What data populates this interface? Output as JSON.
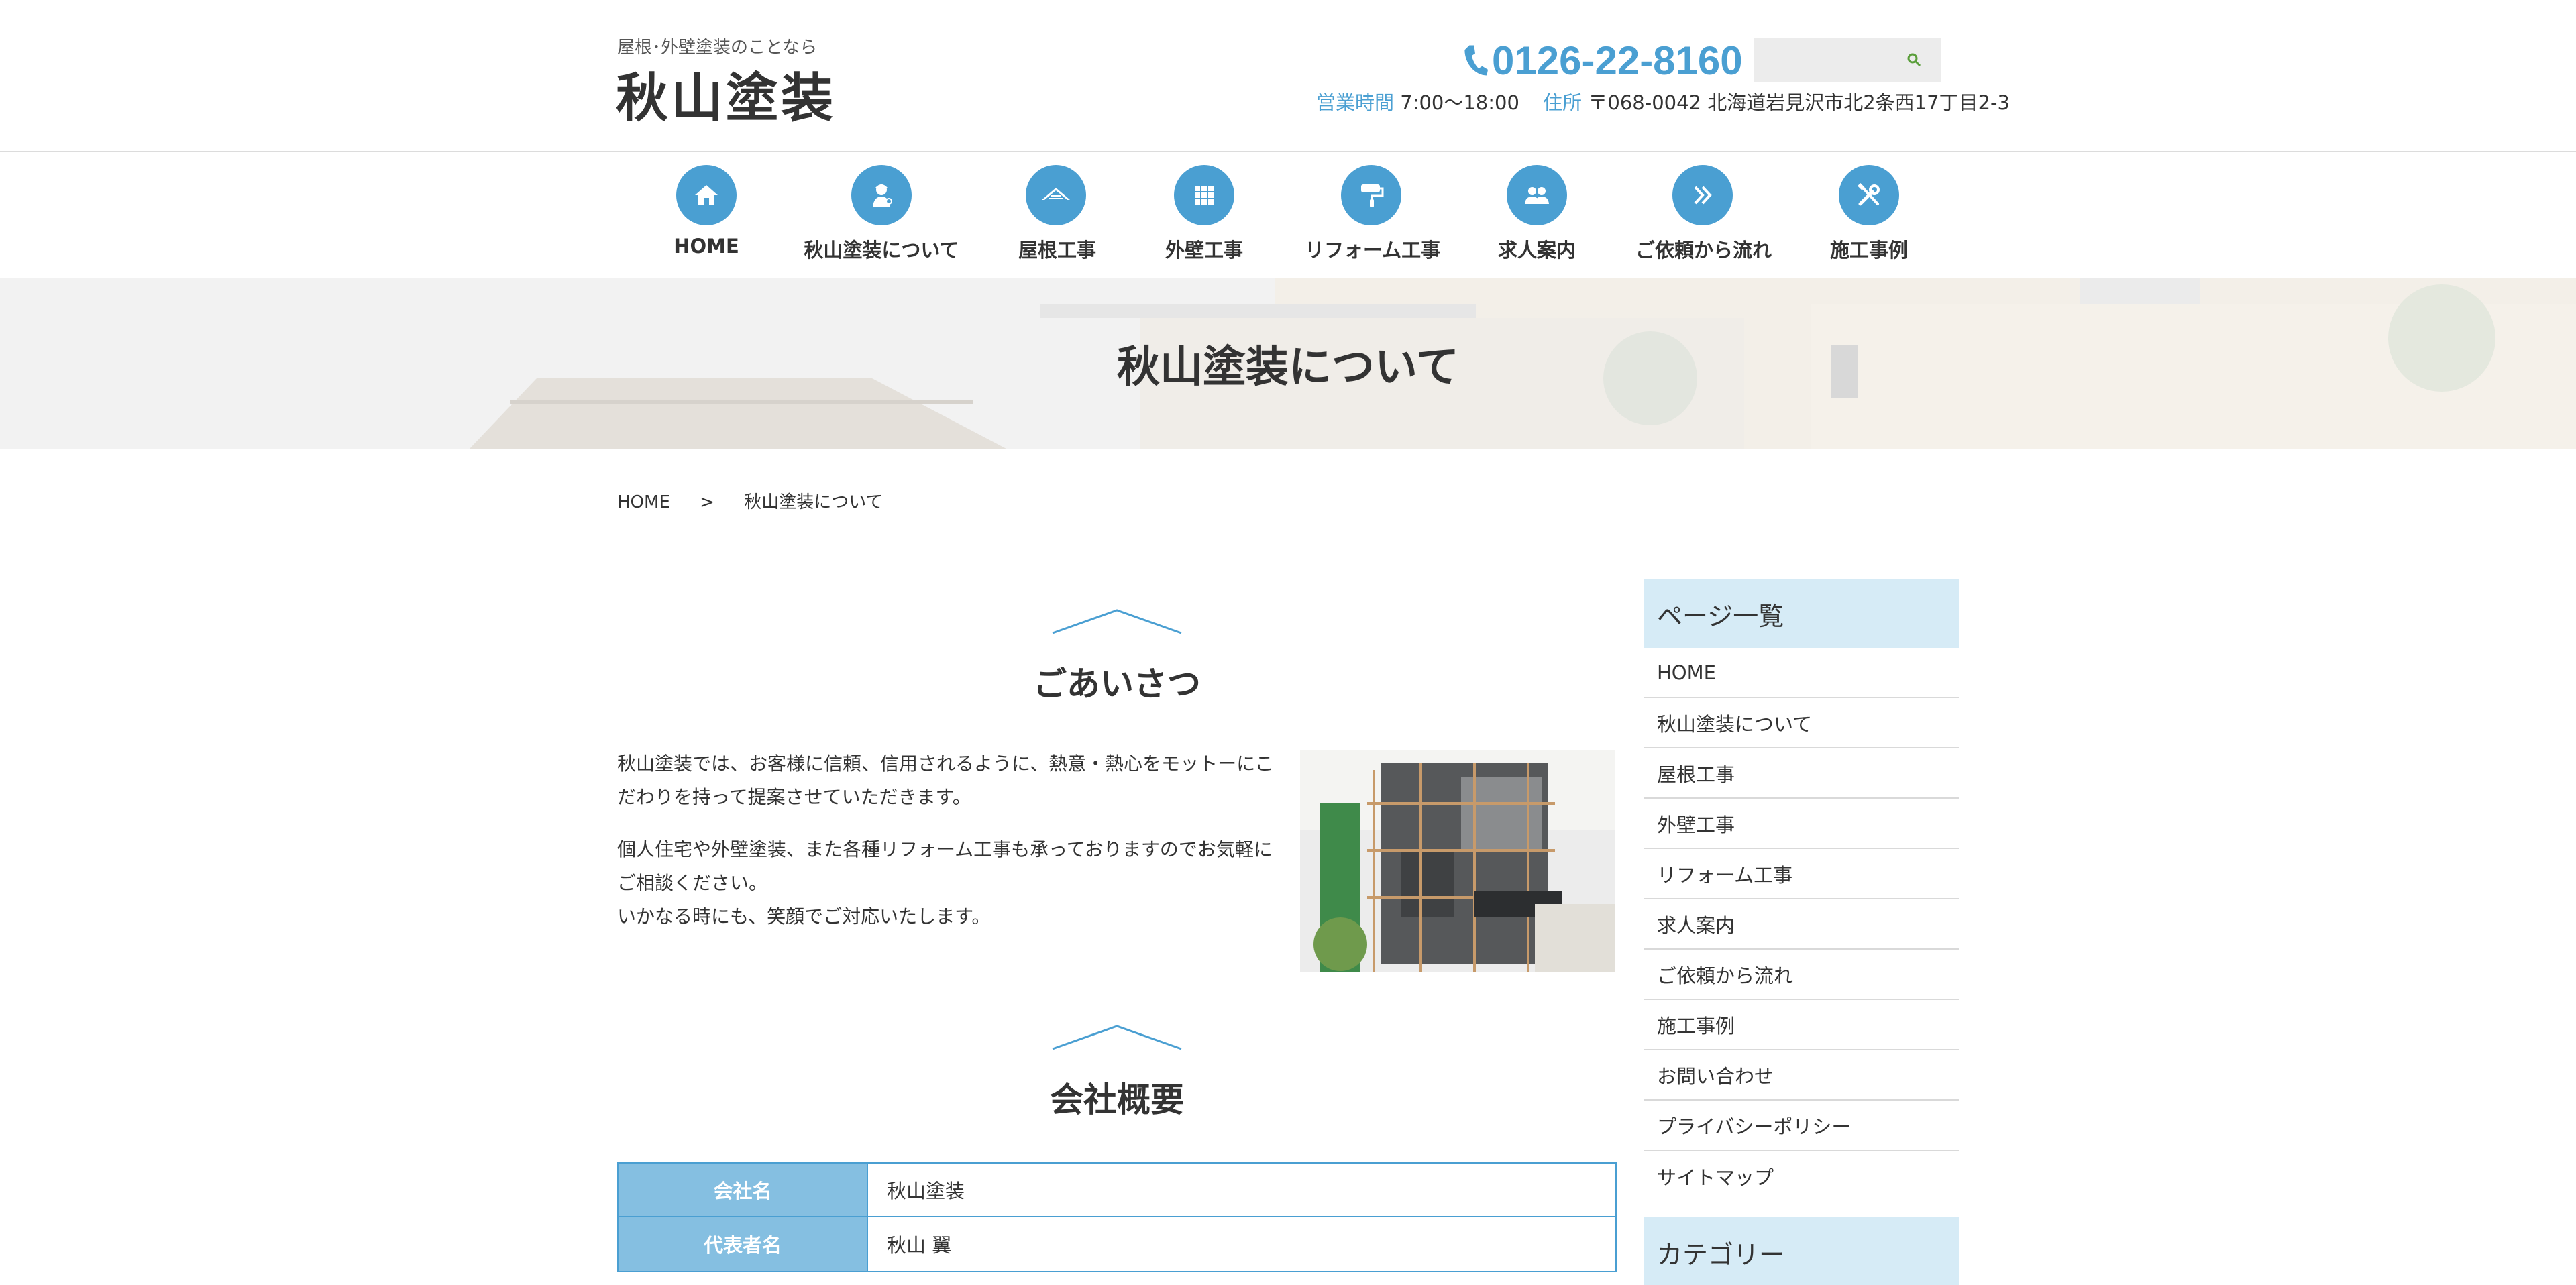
{
  "header": {
    "tagline": "屋根･外壁塗装のことなら",
    "logo": "秋山塗装",
    "phone": "0126-22-8160",
    "hours_label": "営業時間",
    "hours_value": "7:00～18:00",
    "address_label": "住所",
    "address_value": "〒068-0042 北海道岩見沢市北2条西17丁目2-3",
    "search_placeholder": ""
  },
  "nav": {
    "items": [
      {
        "label": "HOME",
        "icon": "house-icon"
      },
      {
        "label": "秋山塗装について",
        "icon": "worker-icon"
      },
      {
        "label": "屋根工事",
        "icon": "roof-icon"
      },
      {
        "label": "外壁工事",
        "icon": "grid-icon"
      },
      {
        "label": "リフォーム工事",
        "icon": "paint-roller-icon"
      },
      {
        "label": "求人案内",
        "icon": "people-icon"
      },
      {
        "label": "ご依頼から流れ",
        "icon": "double-chevron-icon"
      },
      {
        "label": "施工事例",
        "icon": "tools-icon"
      }
    ]
  },
  "hero": {
    "title": "秋山塗装について"
  },
  "breadcrumb": {
    "home": "HOME",
    "separator": ">",
    "current": "秋山塗装について"
  },
  "greeting": {
    "title": "ごあいさつ",
    "para1": "秋山塗装では、お客様に信頼、信用されるように、熱意・熱心をモットーにこだわりを持って提案させていただきます。",
    "para2": "個人住宅や外壁塗装、また各種リフォーム工事も承っておりますのでお気軽にご相談ください。",
    "para3": "いかなる時にも、笑顔でご対応いたします。"
  },
  "company": {
    "title": "会社概要",
    "rows": [
      {
        "label": "会社名",
        "value": "秋山塗装"
      },
      {
        "label": "代表者名",
        "value": "秋山 翼"
      }
    ]
  },
  "sidebar": {
    "heading": "ページ一覧",
    "items": [
      "HOME",
      "秋山塗装について",
      "屋根工事",
      "外壁工事",
      "リフォーム工事",
      "求人案内",
      "ご依頼から流れ",
      "施工事例",
      "お問い合わせ",
      "プライバシーポリシー",
      "サイトマップ"
    ],
    "heading2": "カテゴリー"
  },
  "colors": {
    "accent": "#4a9fd2",
    "table_header": "#85bfe1",
    "sidebar_head": "#d6ebf6"
  }
}
